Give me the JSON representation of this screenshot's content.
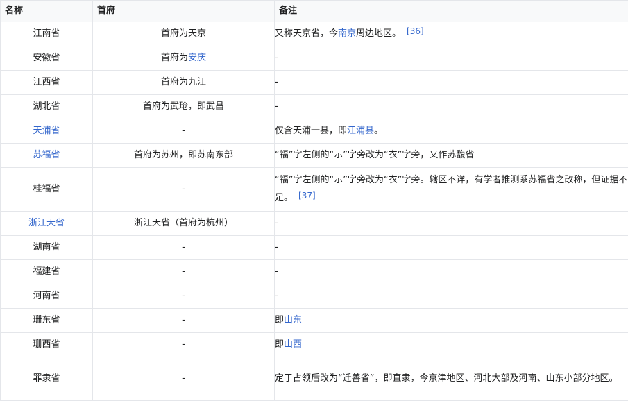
{
  "headers": {
    "name": "名称",
    "capital": "首府",
    "note": "备注"
  },
  "rows": [
    {
      "name": "江南省",
      "capital": "首府为天京",
      "note_pre": "又称天京省，今",
      "note_link": "南京",
      "note_post": "周边地区。",
      "ref": "[36]"
    },
    {
      "name": "安徽省",
      "capital_pre": "首府为",
      "capital_link": "安庆",
      "note": "-"
    },
    {
      "name": "江西省",
      "capital": "首府为九江",
      "note": "-"
    },
    {
      "name": "湖北省",
      "capital": "首府为武玱，即武昌",
      "note": "-"
    },
    {
      "name_link": "天浦省",
      "capital": "-",
      "note_pre": "仅含天浦一县，即",
      "note_link": "江浦县",
      "note_post": "。"
    },
    {
      "name_link": "苏福省",
      "capital": "首府为苏州，即苏南东部",
      "note": "“福”字左侧的“示”字旁改为“衣”字旁，又作苏馥省"
    },
    {
      "name": "桂福省",
      "capital": "-",
      "note": "“福”字左侧的“示”字旁改为“衣”字旁。辖区不详，有学者推测系苏福省之改称，但证据不足。",
      "ref": "[37]"
    },
    {
      "name_link": "浙江天省",
      "capital": "浙江天省（首府为杭州）",
      "note": "-"
    },
    {
      "name": "湖南省",
      "capital": "-",
      "note": "-"
    },
    {
      "name": "福建省",
      "capital": "-",
      "note": "-"
    },
    {
      "name": "河南省",
      "capital": "-",
      "note": "-"
    },
    {
      "name": "珊东省",
      "capital": "-",
      "note_pre": "即",
      "note_link": "山东"
    },
    {
      "name": "珊西省",
      "capital": "-",
      "note_pre": "即",
      "note_link": "山西"
    },
    {
      "name": "罪隶省",
      "capital": "-",
      "note": "定于占领后改为“迁善省”，即直隶，今京津地区、河北大部及河南、山东小部分地区。"
    }
  ]
}
